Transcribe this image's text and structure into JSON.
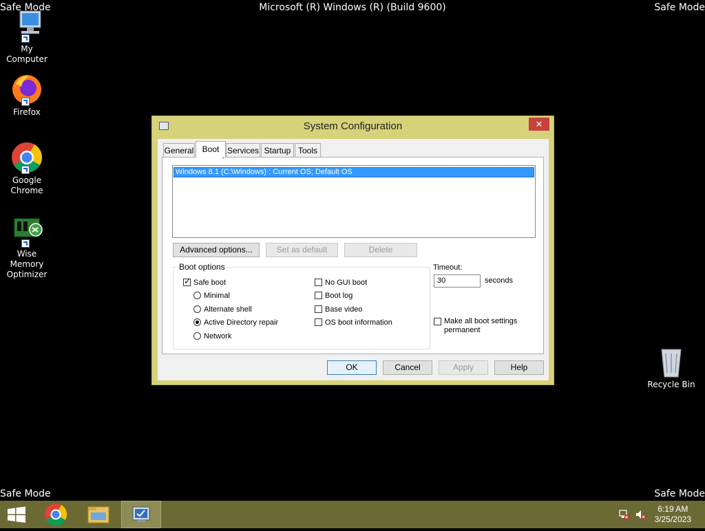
{
  "desktop": {
    "safe_mode_label": "Safe Mode",
    "build_text": "Microsoft (R) Windows (R) (Build 9600)",
    "icons": [
      {
        "label": "My Computer"
      },
      {
        "label": "Firefox"
      },
      {
        "label": "Google Chrome"
      },
      {
        "label": "Wise Memory Optimizer"
      },
      {
        "label": "Recycle Bin"
      }
    ]
  },
  "dialog": {
    "title": "System Configuration",
    "close_glyph": "✕",
    "tabs": [
      "General",
      "Boot",
      "Services",
      "Startup",
      "Tools"
    ],
    "active_tab": "Boot",
    "os_entries": [
      "Windows 8.1 (C:\\Windows) : Current OS; Default OS"
    ],
    "buttons": {
      "advanced": "Advanced options...",
      "set_default": "Set as default",
      "delete": "Delete"
    },
    "boot_options": {
      "label": "Boot options",
      "safe_boot": {
        "label": "Safe boot",
        "checked": true
      },
      "radios": [
        {
          "label": "Minimal",
          "selected": false
        },
        {
          "label": "Alternate shell",
          "selected": false
        },
        {
          "label": "Active Directory repair",
          "selected": true
        },
        {
          "label": "Network",
          "selected": false
        }
      ],
      "checks": [
        {
          "label": "No GUI boot",
          "checked": false
        },
        {
          "label": "Boot log",
          "checked": false
        },
        {
          "label": "Base video",
          "checked": false
        },
        {
          "label": "OS boot information",
          "checked": false
        }
      ]
    },
    "timeout": {
      "label": "Timeout:",
      "value": "30",
      "unit": "seconds"
    },
    "make_permanent": {
      "line1": "Make all boot settings",
      "line2": "permanent",
      "checked": false
    },
    "footer": {
      "ok": "OK",
      "cancel": "Cancel",
      "apply": "Apply",
      "help": "Help"
    }
  },
  "taskbar": {
    "clock_time": "6:19 AM",
    "clock_date": "3/25/2023"
  }
}
